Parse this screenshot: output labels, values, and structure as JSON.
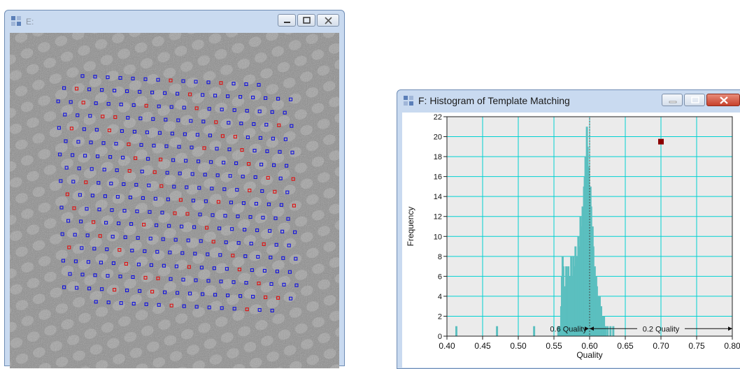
{
  "window_e": {
    "title": "E:",
    "marker_colors": {
      "selected": "#1010e0",
      "rejected": "#e01010"
    }
  },
  "window_f": {
    "title": "F: Histogram of Template Matching",
    "colors": {
      "bar": "#5bbfbf",
      "grid": "#00d2d2",
      "marker": "#8b0000",
      "plot_bg": "#ebebeb"
    },
    "chart_data": {
      "type": "bar",
      "title": "",
      "xlabel": "Quality",
      "ylabel": "Frequency",
      "xlim": [
        0.4,
        0.8
      ],
      "ylim": [
        0,
        22
      ],
      "x_ticks": [
        "0.40",
        "0.45",
        "0.50",
        "0.55",
        "0.60",
        "0.65",
        "0.70",
        "0.75",
        "0.80"
      ],
      "y_ticks": [
        "0",
        "2",
        "4",
        "6",
        "8",
        "10",
        "12",
        "14",
        "16",
        "18",
        "20",
        "22"
      ],
      "bin_width": 0.0025,
      "bins": [
        [
          0.413,
          1
        ],
        [
          0.47,
          1
        ],
        [
          0.522,
          1
        ],
        [
          0.556,
          1
        ],
        [
          0.558,
          1
        ],
        [
          0.56,
          3
        ],
        [
          0.561,
          6
        ],
        [
          0.562,
          8
        ],
        [
          0.563,
          7
        ],
        [
          0.565,
          5
        ],
        [
          0.567,
          7
        ],
        [
          0.568,
          6
        ],
        [
          0.57,
          7
        ],
        [
          0.572,
          6
        ],
        [
          0.574,
          8
        ],
        [
          0.575,
          6
        ],
        [
          0.577,
          8
        ],
        [
          0.579,
          7
        ],
        [
          0.58,
          9
        ],
        [
          0.582,
          8
        ],
        [
          0.584,
          10
        ],
        [
          0.585,
          9
        ],
        [
          0.587,
          12
        ],
        [
          0.589,
          11
        ],
        [
          0.59,
          13
        ],
        [
          0.592,
          15
        ],
        [
          0.593,
          16
        ],
        [
          0.594,
          18
        ],
        [
          0.596,
          21
        ],
        [
          0.597,
          19
        ],
        [
          0.599,
          17
        ],
        [
          0.601,
          15
        ],
        [
          0.602,
          13
        ],
        [
          0.604,
          11
        ],
        [
          0.605,
          9
        ],
        [
          0.607,
          7
        ],
        [
          0.609,
          6
        ],
        [
          0.61,
          5
        ],
        [
          0.612,
          4
        ],
        [
          0.614,
          4
        ],
        [
          0.616,
          3
        ],
        [
          0.618,
          2
        ],
        [
          0.62,
          2
        ],
        [
          0.622,
          1
        ],
        [
          0.625,
          1
        ],
        [
          0.629,
          1
        ],
        [
          0.633,
          1
        ]
      ],
      "threshold": 0.6,
      "marker_point": {
        "x": 0.7,
        "y": 19.5
      },
      "annotations": [
        {
          "text": "0.6 Quality",
          "from": 0.6,
          "to": 0.6
        },
        {
          "text": "0.2 Quality",
          "from": 0.6,
          "to": 0.8
        }
      ]
    }
  }
}
